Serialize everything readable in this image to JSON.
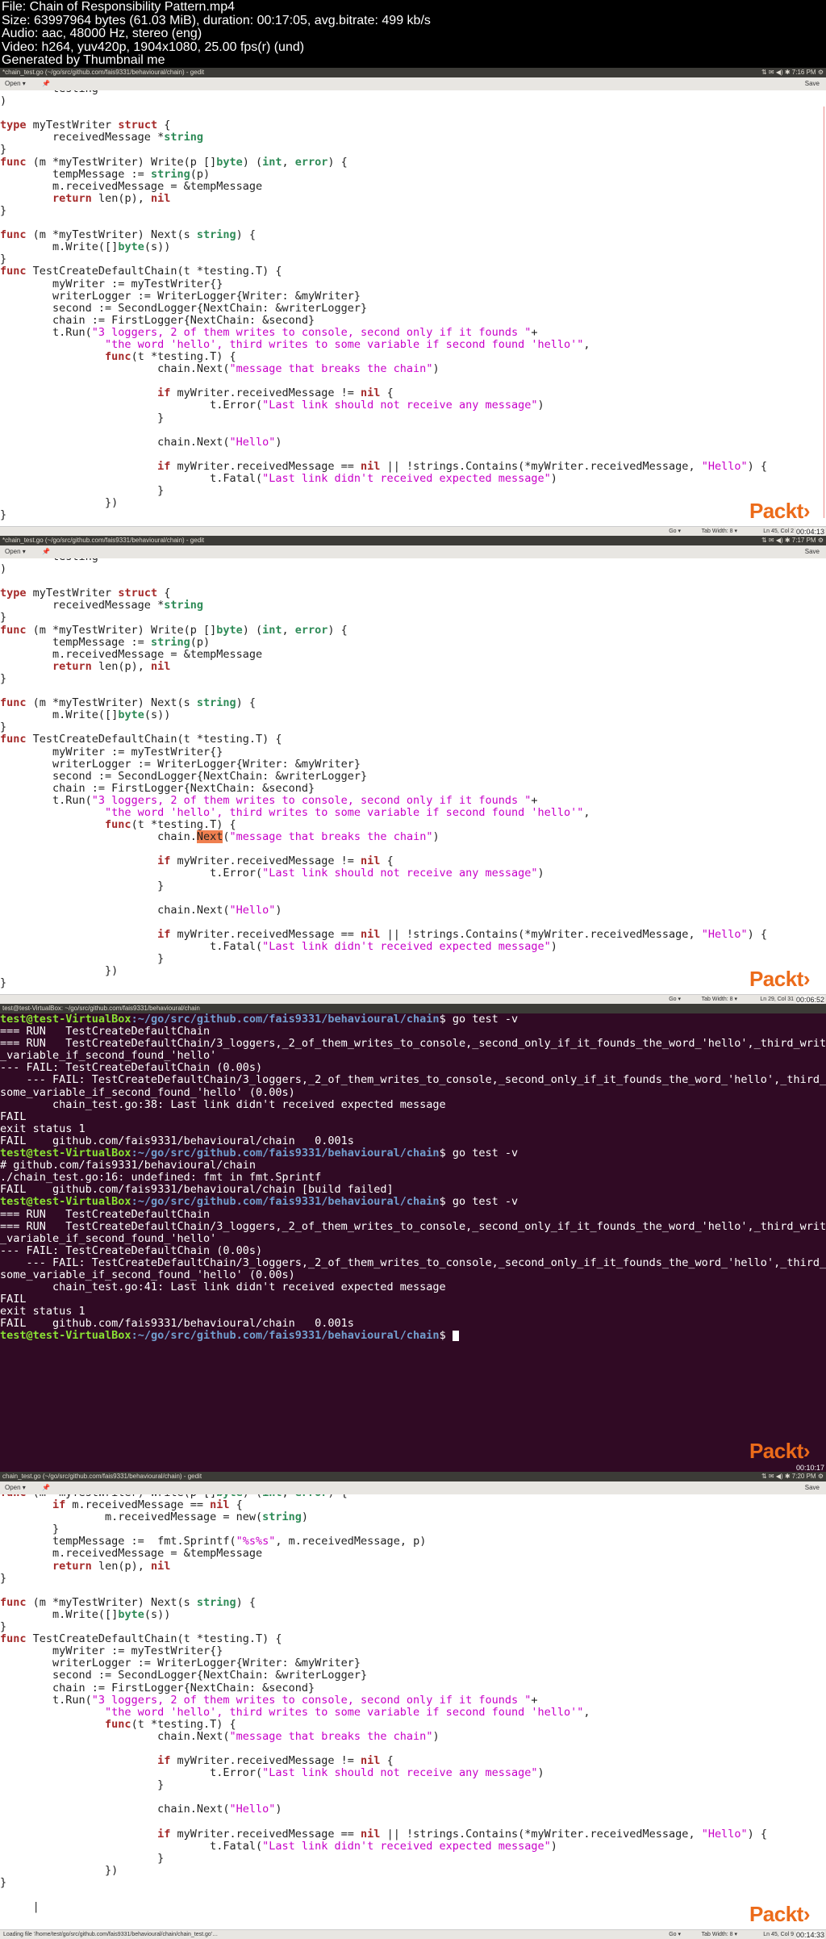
{
  "header": {
    "line1": "File: Chain of Responsibility Pattern.mp4",
    "line2": "Size: 63997964 bytes (61.03 MiB), duration: 00:17:05, avg.bitrate: 499 kb/s",
    "line3": "Audio: aac, 48000 Hz, stereo (eng)",
    "line4": "Video: h264, yuv420p, 1904x1080, 25.00 fps(r) (und)",
    "line5": "Generated by Thumbnail me"
  },
  "frames": {
    "f1": {
      "title": "*chain_test.go (~/go/src/github.com/fais9331/behavioural/chain) - gedit",
      "tray": "⇅  ✉  ◀)  ✱  7:16 PM  ⚙",
      "open_label": "Open ▾",
      "save_label": "Save",
      "status_go": "Go ▾",
      "status_tab": "Tab Width: 8 ▾",
      "status_ln": "Ln 45, Col 2",
      "timestamp": "00:04:13",
      "logo": "Packt›"
    },
    "f2": {
      "title": "*chain_test.go (~/go/src/github.com/fais9331/behavioural/chain) - gedit",
      "tray": "⇅  ✉  ◀)  ✱  7:17 PM  ⚙",
      "open_label": "Open ▾",
      "save_label": "Save",
      "status_go": "Go ▾",
      "status_tab": "Tab Width: 8 ▾",
      "status_ln": "Ln 29, Col 31",
      "timestamp": "00:06:52",
      "logo": "Packt›"
    },
    "f3": {
      "title": "test@test-VirtualBox: ~/go/src/github.com/fais9331/behavioural/chain",
      "timestamp": "00:10:17",
      "logo": "Packt›"
    },
    "f4": {
      "title": "chain_test.go (~/go/src/github.com/fais9331/behavioural/chain) - gedit",
      "tray": "⇅  ✉  ◀)  ✱  7:20 PM  ⚙",
      "open_label": "Open ▾",
      "save_label": "Save",
      "status_load": "Loading file '/home/test/go/src/github.com/fais9331/behavioural/chain/chain_test.go'…",
      "status_go": "Go ▾",
      "status_tab": "Tab Width: 8 ▾",
      "status_ln": "Ln 45, Col 9",
      "timestamp": "00:14:33",
      "logo": "Packt›"
    }
  },
  "terminal": {
    "prompt_user": "test@test-VirtualBox",
    "prompt_path": ":~/go/src/github.com/fais9331/behavioural/chain",
    "command": "$ go test -v"
  },
  "accent": {
    "packt": "#ec6b1a",
    "terminal_bg": "#300a24",
    "keyword": "#a52a2a",
    "string": "#c800c8",
    "type": "#2e8b57"
  }
}
